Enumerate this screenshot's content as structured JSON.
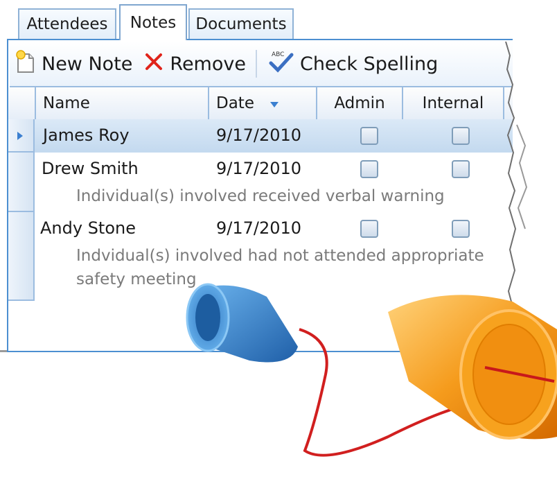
{
  "tabs": [
    {
      "label": "Attendees"
    },
    {
      "label": "Notes"
    },
    {
      "label": "Documents"
    }
  ],
  "toolbar": {
    "new_note": "New Note",
    "remove": "Remove",
    "check_spelling": "Check Spelling",
    "icons": [
      "new-note-icon",
      "remove-icon",
      "spell-check-icon"
    ],
    "spell_badge": "ABC"
  },
  "grid": {
    "columns": [
      "Name",
      "Date",
      "Admin",
      "Internal"
    ],
    "rows": [
      {
        "name": "James Roy",
        "date": "9/17/2010",
        "admin": false,
        "internal": false,
        "note": ""
      },
      {
        "name": "Drew Smith",
        "date": "9/17/2010",
        "admin": false,
        "internal": false,
        "note": "Individual(s) involved received verbal warning"
      },
      {
        "name": "Andy Stone",
        "date": "9/17/2010",
        "admin": false,
        "internal": false,
        "note_line1": "Indvidual(s) involved had not attended appropriate",
        "note_line2": "safety meeting"
      }
    ],
    "selected_row": 0
  },
  "colors": {
    "accent": "#4c8fd1",
    "selected_row": "#cfe1f3",
    "remove_x": "#e0241b",
    "can_blue": "#3f8fd2",
    "can_orange": "#f39a1c",
    "string": "#d11f1f"
  }
}
